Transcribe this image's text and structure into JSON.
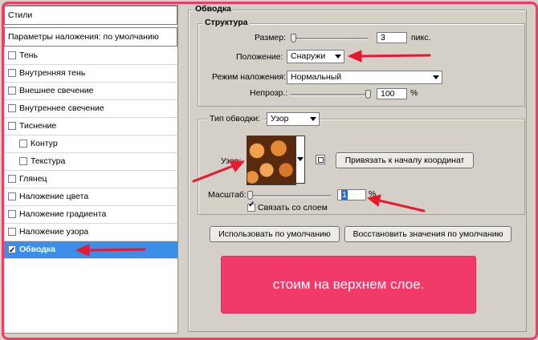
{
  "left_panel": {
    "header": "Стили",
    "blending": "Параметры наложения: по умолчанию",
    "items": [
      {
        "label": "Тень",
        "checked": false,
        "indent": false
      },
      {
        "label": "Внутренняя тень",
        "checked": false,
        "indent": false
      },
      {
        "label": "Внешнее свечение",
        "checked": false,
        "indent": false
      },
      {
        "label": "Внутреннее свечение",
        "checked": false,
        "indent": false
      },
      {
        "label": "Тиснение",
        "checked": false,
        "indent": false
      },
      {
        "label": "Контур",
        "checked": false,
        "indent": true
      },
      {
        "label": "Текстура",
        "checked": false,
        "indent": true
      },
      {
        "label": "Глянец",
        "checked": false,
        "indent": false
      },
      {
        "label": "Наложение цвета",
        "checked": false,
        "indent": false
      },
      {
        "label": "Наложение градиента",
        "checked": false,
        "indent": false
      },
      {
        "label": "Наложение узора",
        "checked": false,
        "indent": false
      },
      {
        "label": "Обводка",
        "checked": true,
        "indent": false,
        "selected": true
      }
    ]
  },
  "stroke": {
    "title": "Обводка",
    "structure_title": "Структура",
    "size_label": "Размер:",
    "size_value": "3",
    "size_unit": "пикс.",
    "position_label": "Положение:",
    "position_value": "Снаружи",
    "blend_label": "Режим наложения:",
    "blend_value": "Нормальный",
    "opacity_label": "Непрозр.:",
    "opacity_value": "100",
    "opacity_unit": "%",
    "fill_type_label": "Тип обводки:",
    "fill_type_value": "Узор",
    "pattern_label": "Узор:",
    "snap_button": "Привязать к началу координат",
    "scale_label": "Масштаб:",
    "scale_value": "1",
    "scale_unit": "%",
    "link_label": "Связать со слоем",
    "link_checked": true,
    "default_button": "Использовать по умолчанию",
    "reset_button": "Восстановить значения по умолчанию"
  },
  "annotation": {
    "text": "стоим на верхнем слое.",
    "color": "#f23a6a",
    "arrow_color": "#e8182e"
  }
}
